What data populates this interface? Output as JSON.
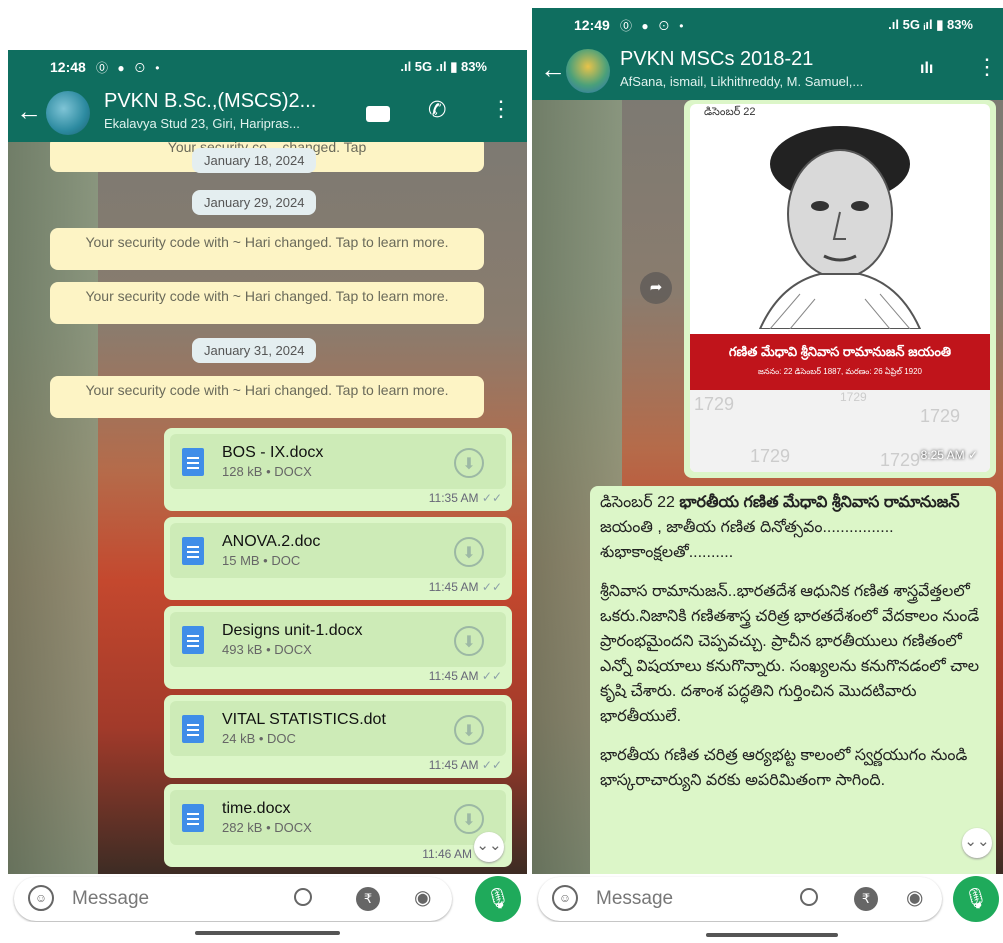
{
  "left": {
    "status": {
      "time": "12:48",
      "icons": "⓪ ● ⊙ •",
      "right": ".ıl 5G .ıl ▮ 83%"
    },
    "header": {
      "title": "PVKN B.Sc.,(MSCS)2...",
      "subtitle": "Ekalavya Stud 23, Giri, Haripras..."
    },
    "partial_system": {
      "text": "Your security co... changed. Tap"
    },
    "dates": [
      "January 18, 2024",
      "January 29, 2024",
      "January 31, 2024"
    ],
    "system_messages": [
      "Your security code with ~ Hari changed. Tap to learn more.",
      "Your security code with ~ Hari changed. Tap to learn more.",
      "Your security code with ~ Hari changed. Tap to learn more."
    ],
    "files": [
      {
        "name": "BOS - IX.docx",
        "meta": "128 kB • DOCX",
        "time": "11:35 AM"
      },
      {
        "name": "ANOVA.2.doc",
        "meta": "15 MB • DOC",
        "time": "11:45 AM"
      },
      {
        "name": "Designs unit-1.docx",
        "meta": "493 kB • DOCX",
        "time": "11:45 AM"
      },
      {
        "name": "VITAL STATISTICS.dot",
        "meta": "24 kB • DOC",
        "time": "11:45 AM"
      },
      {
        "name": "time.docx",
        "meta": "282 kB • DOCX",
        "time": "11:46 AM"
      }
    ],
    "input": {
      "placeholder": "Message"
    }
  },
  "right": {
    "status": {
      "time": "12:49",
      "icons": "⓪ ● ⊙ •",
      "right": ".ıl 5G ᵢıl ▮ 83%"
    },
    "header": {
      "title": "PVKN MSCs 2018-21",
      "subtitle": "AfSana, ismail, Likhithreddy, M. Samuel,..."
    },
    "image_message": {
      "header": "డిసెంబర్ 22",
      "banner_title": "గణిత మేధావి శ్రీనివాస రామానుజన్ జయంతి",
      "banner_sub": "జననం: 22 డిసెంబర్ 1887, మరణం: 26 ఏప్రిల్ 1920",
      "numbers": [
        "1729",
        "1729",
        "1729",
        "1729",
        "1729"
      ],
      "time": "8:25 AM"
    },
    "text_message": {
      "p1_normal1": "డిసెంబర్ 22 ",
      "p1_bold": "భారతీయ గణిత మేధావి శ్రీనివాస రామానుజన్",
      "p1_normal2": " జయంతి , జాతీయ గణిత దినోత్సవం................ శుభాకాంక్షలతో..........",
      "p2": "శ్రీనివాస రామానుజన్..భారతదేశ ఆధునిక గణిత శాస్త్రవేత్తలలో ఒకరు.నిజానికి గణితశాస్త్ర చరిత్ర భారతదేశంలో వేదకాలం నుండే ప్రారంభమైందని చెప్పవచ్చు. ప్రాచీన భారతీయులు గణితంలో ఎన్నో విషయాలు కనుగొన్నారు. సంఖ్యలను కనుగొనడంలో చాల కృషి చేశారు. దశాంశ పద్ధతిని గుర్తించిన మొదటివారు భారతీయులే.",
      "p3": "భారతీయ గణిత చరిత్ర ఆర్యభట్ట కాలంలో స్వర్ణయుగం నుండి భాస్కరాచార్యుని వరకు అపరిమితంగా సాగింది."
    },
    "input": {
      "placeholder": "Message"
    }
  },
  "icons": {
    "back": "←",
    "video": "▭",
    "call": "✆",
    "menu": "⋮",
    "wave": "ılı",
    "download": "⬇",
    "attach": "📎",
    "camera": "◉",
    "mic": "🎙",
    "scroll_down": "⌄⌄",
    "forward": "➦",
    "rupee": "₹",
    "emoji": "☺"
  },
  "colors": {
    "header": "#0f6e5f",
    "outgoing": "#dcf6c8",
    "system": "#fdf4c5",
    "mic": "#1faa5b"
  }
}
